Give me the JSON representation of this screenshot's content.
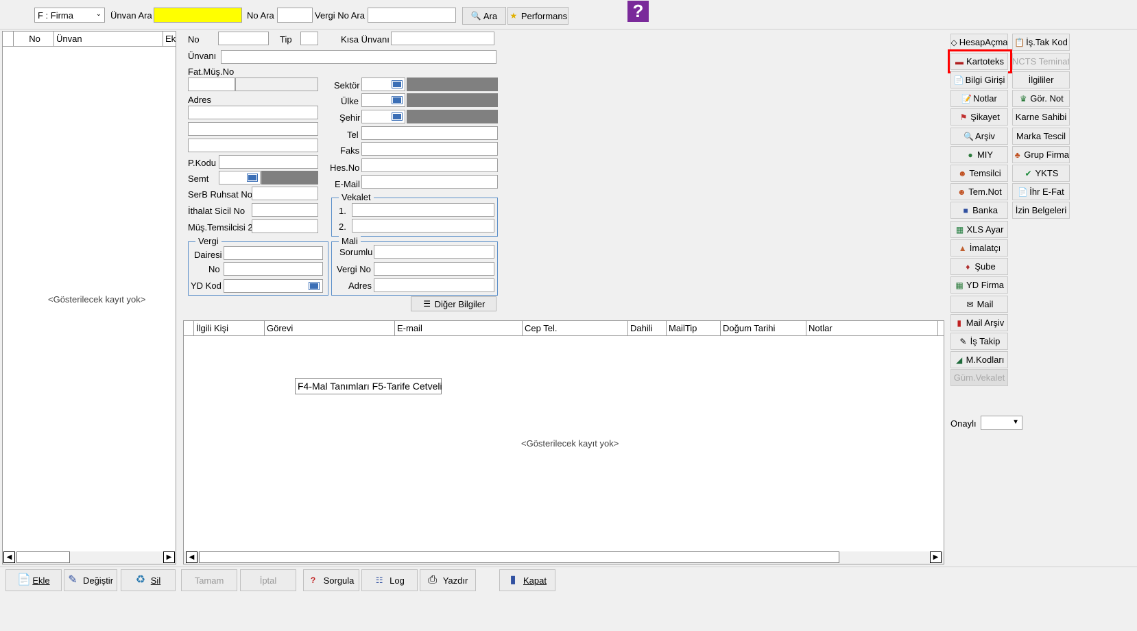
{
  "toolbar": {
    "filter_select": "F : Firma",
    "unvan_ara_label": "Ünvan Ara",
    "unvan_ara_value": "",
    "no_ara_label": "No Ara",
    "vergi_no_ara_label": "Vergi No Ara",
    "ara_button": "Ara",
    "performans_button": "Performans"
  },
  "left_grid": {
    "columns": [
      "No",
      "Ünvan",
      "Ek"
    ],
    "empty_text": "<Gösterilecek kayıt yok>"
  },
  "form": {
    "no_label": "No",
    "tip_label": "Tip",
    "kisa_unvan_label": "Kısa Ünvanı",
    "unvani_label": "Ünvanı",
    "fat_mus_no_label": "Fat.Müş.No",
    "adres_label": "Adres",
    "pkodu_label": "P.Kodu",
    "semt_label": "Semt",
    "serb_ruhsat_label": "SerB Ruhsat No",
    "ithalat_sicil_label": "İthalat Sicil No",
    "mus_temsilcisi_label": "Müş.Temsilcisi 2",
    "sektor_label": "Sektör",
    "ulke_label": "Ülke",
    "sehir_label": "Şehir",
    "tel_label": "Tel",
    "faks_label": "Faks",
    "hes_no_label": "Hes.No",
    "email_label": "E-Mail",
    "vekalet": {
      "title": "Vekalet",
      "row1": "1.",
      "row2": "2."
    },
    "vergi": {
      "title": "Vergi",
      "dairesi_label": "Dairesi",
      "no_label": "No",
      "yd_kod_label": "YD Kod"
    },
    "mali": {
      "title": "Mali",
      "sorumlu_label": "Sorumlu",
      "vergi_no_label": "Vergi No",
      "adres_label": "Adres"
    },
    "diger_bilgiler_button": "Diğer Bilgiler"
  },
  "contacts_grid": {
    "columns": [
      "İlgili Kişi",
      "Görevi",
      "E-mail",
      "Cep Tel.",
      "Dahili",
      "MailTip",
      "Doğum Tarihi",
      "Notlar"
    ],
    "empty_text": "<Gösterilecek kayıt yok>",
    "hint_text": "F4-Mal Tanımları F5-Tarife Cetveli"
  },
  "right_buttons": {
    "col1": [
      {
        "label": "HesapAçma",
        "icon": "tag-icon",
        "disabled": false
      },
      {
        "label": "Kartoteks",
        "icon": "card-icon",
        "disabled": false
      },
      {
        "label": "Bilgi Girişi",
        "icon": "docs-icon",
        "disabled": false
      },
      {
        "label": "Notlar",
        "icon": "note-icon",
        "disabled": false
      },
      {
        "label": "Şikayet",
        "icon": "complaint-icon",
        "disabled": false
      },
      {
        "label": "Arşiv",
        "icon": "archive-icon",
        "disabled": false
      },
      {
        "label": "MIY",
        "icon": "globe-icon",
        "disabled": false
      },
      {
        "label": "Temsilci",
        "icon": "people-icon",
        "disabled": false
      },
      {
        "label": "Tem.Not",
        "icon": "people-note-icon",
        "disabled": false
      },
      {
        "label": "Banka",
        "icon": "bank-icon",
        "disabled": false
      },
      {
        "label": "XLS Ayar",
        "icon": "excel-icon",
        "disabled": false
      },
      {
        "label": "İmalatçı",
        "icon": "factory-icon",
        "disabled": false
      },
      {
        "label": "Şube",
        "icon": "branch-icon",
        "disabled": false
      },
      {
        "label": "YD Firma",
        "icon": "foreign-firm-icon",
        "disabled": false
      },
      {
        "label": "Mail",
        "icon": "mail-icon",
        "disabled": false
      },
      {
        "label": "Mail Arşiv",
        "icon": "mail-archive-icon",
        "disabled": false
      },
      {
        "label": "İş Takip",
        "icon": "task-icon",
        "disabled": false
      },
      {
        "label": "M.Kodları",
        "icon": "book-icon",
        "disabled": false
      },
      {
        "label": "Güm.Vekalet",
        "icon": "",
        "disabled": true
      }
    ],
    "col2": [
      {
        "label": "İş.Tak Kod",
        "icon": "clipboard-icon",
        "disabled": false
      },
      {
        "label": "NCTS Teminat",
        "icon": "",
        "disabled": true
      },
      {
        "label": "İlgililer",
        "icon": "",
        "disabled": false
      },
      {
        "label": "Gör. Not",
        "icon": "view-note-icon",
        "disabled": false
      },
      {
        "label": "Karne Sahibi",
        "icon": "",
        "disabled": false
      },
      {
        "label": "Marka Tescil",
        "icon": "",
        "disabled": false
      },
      {
        "label": "Grup Firma",
        "icon": "group-icon",
        "disabled": false
      },
      {
        "label": "YKTS",
        "icon": "check-icon",
        "disabled": false
      },
      {
        "label": "İhr E-Fat",
        "icon": "invoice-icon",
        "disabled": false
      },
      {
        "label": "İzin Belgeleri",
        "icon": "",
        "disabled": false
      }
    ],
    "onayli_label": "Onaylı"
  },
  "bottom_buttons": {
    "ekle": "Ekle",
    "degistir": "Değiştir",
    "sil": "Sil",
    "tamam": "Tamam",
    "iptal": "İptal",
    "sorgula": "Sorgula",
    "log": "Log",
    "yazdir": "Yazdır",
    "kapat": "Kapat"
  },
  "colors": {
    "highlight_input": "#ffff00",
    "selection_outline": "#ff0000",
    "group_border": "#5b8fc9",
    "help_icon": "#7a2a9a"
  }
}
